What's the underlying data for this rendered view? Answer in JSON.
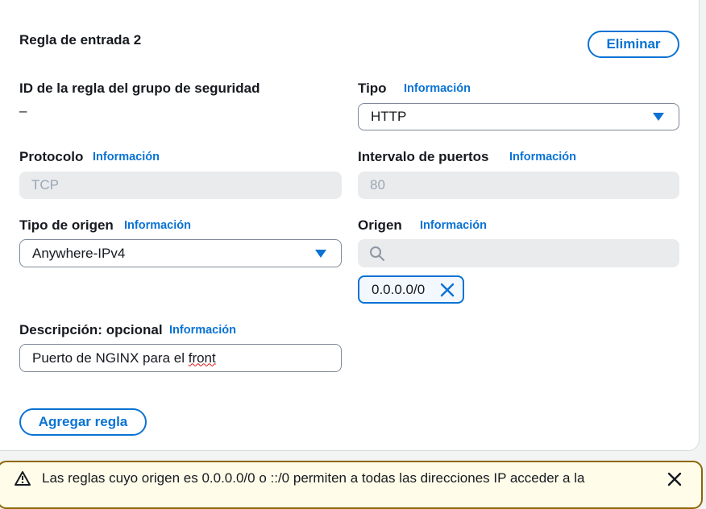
{
  "rule": {
    "title": "Regla de entrada 2",
    "delete_label": "Eliminar",
    "info_label": "Información",
    "rule_id": {
      "label": "ID de la regla del grupo de seguridad",
      "value": "–"
    },
    "type": {
      "label": "Tipo",
      "value": "HTTP"
    },
    "protocol": {
      "label": "Protocolo",
      "value": "TCP"
    },
    "port_range": {
      "label": "Intervalo de puertos",
      "value": "80"
    },
    "source_type": {
      "label": "Tipo de origen",
      "value": "Anywhere-IPv4"
    },
    "source": {
      "label": "Origen",
      "search_value": "",
      "token": "0.0.0.0/0"
    },
    "description": {
      "label": "Descripción: opcional",
      "value_main": "Puerto de NGINX para el ",
      "value_flagged": "front"
    }
  },
  "add_rule_label": "Agregar regla",
  "alert": {
    "text": "Las reglas cuyo origen es 0.0.0.0/0 o ::/0 permiten a todas las direcciones IP acceder a la"
  },
  "colors": {
    "accent": "#0972d3",
    "warning_border": "#8d6605",
    "disabled_bg": "#e9ebed"
  },
  "icons": [
    "caret-down-icon",
    "search-icon",
    "remove-token-icon",
    "warning-icon",
    "close-icon"
  ]
}
